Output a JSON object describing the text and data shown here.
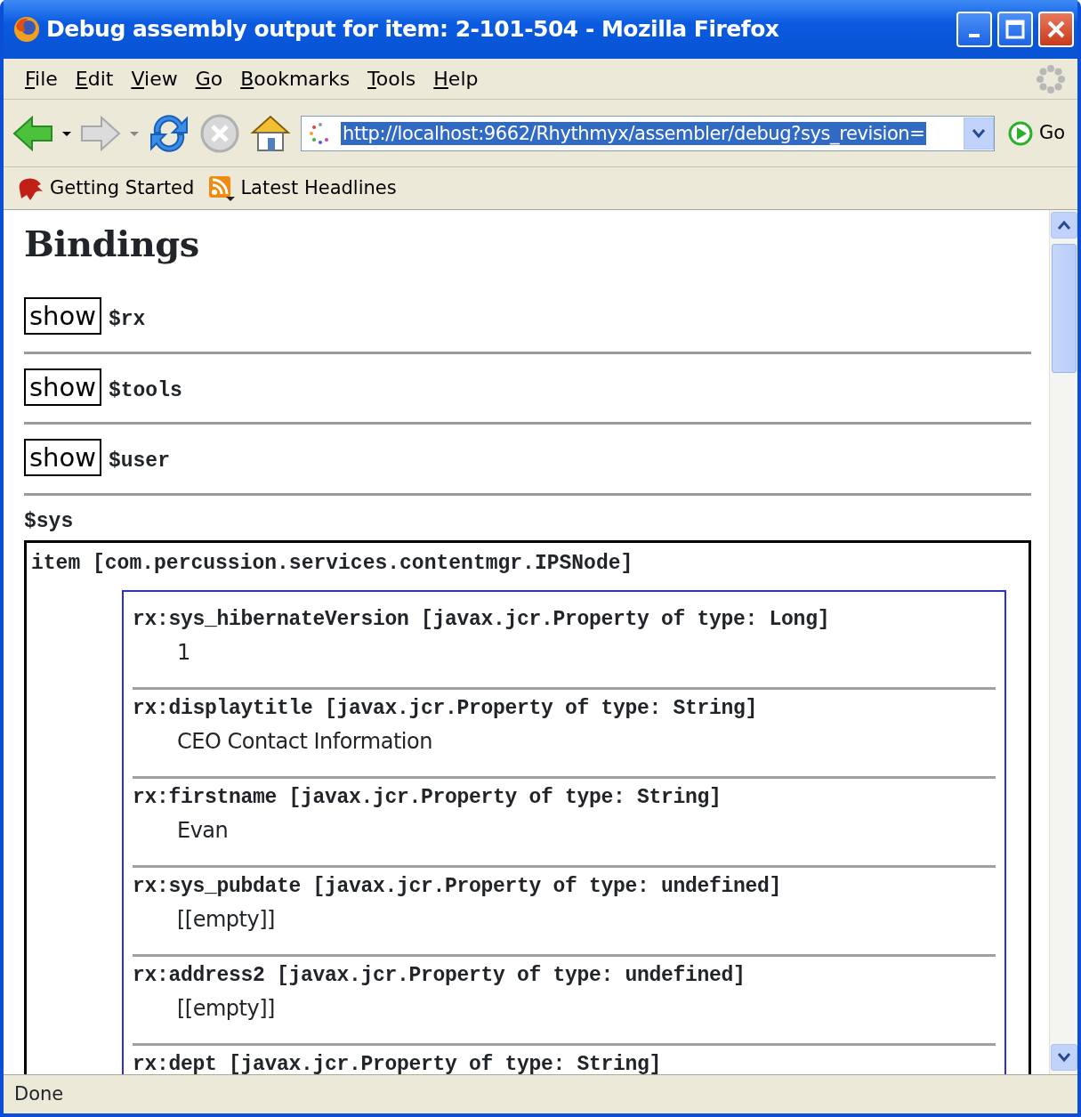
{
  "window": {
    "title": "Debug assembly output for item: 2-101-504 - Mozilla Firefox"
  },
  "menu": [
    "File",
    "Edit",
    "View",
    "Go",
    "Bookmarks",
    "Tools",
    "Help"
  ],
  "toolbar": {
    "url": "http://localhost:9662/Rhythmyx/assembler/debug?sys_revision=",
    "go": "Go"
  },
  "bookmarks": [
    "Getting Started",
    "Latest Headlines"
  ],
  "content": {
    "heading": "Bindings",
    "bindings": [
      {
        "button": "show",
        "name": "$rx"
      },
      {
        "button": "show",
        "name": "$tools"
      },
      {
        "button": "show",
        "name": "$user"
      }
    ],
    "sys": {
      "label": "$sys",
      "item": "item [com.percussion.services.contentmgr.IPSNode]",
      "properties": [
        {
          "name": "rx:sys_hibernateVersion [javax.jcr.Property of type: Long]",
          "value": "1"
        },
        {
          "name": "rx:displaytitle [javax.jcr.Property of type: String]",
          "value": "CEO Contact Information"
        },
        {
          "name": "rx:firstname [javax.jcr.Property of type: String]",
          "value": "Evan"
        },
        {
          "name": "rx:sys_pubdate [javax.jcr.Property of type: undefined]",
          "value": "[[empty]]"
        },
        {
          "name": "rx:address2 [javax.jcr.Property of type: undefined]",
          "value": "[[empty]]"
        },
        {
          "name": "rx:dept [javax.jcr.Property of type: String]"
        }
      ]
    }
  },
  "status_bar": "Done"
}
